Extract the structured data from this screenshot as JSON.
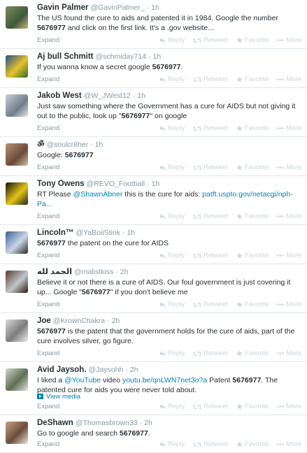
{
  "actions": {
    "reply": "Reply",
    "retweet": "Retweet",
    "favorite": "Favorite",
    "more": "More"
  },
  "expand_label": "Expand",
  "view_media_label": "View media",
  "colors": {
    "link": "#0084b4",
    "muted": "#8899a6",
    "action": "#ccd6dd",
    "divider": "#e1e8ed"
  },
  "tweets": [
    {
      "fullname": "Gavin Palmer",
      "username": "@GavinPalmer_",
      "time": "· 1h",
      "segments": [
        {
          "t": "The US found the cure to aids and patented it in 1984. Google the number "
        },
        {
          "t": "5676977",
          "b": true
        },
        {
          "t": " and click on the first link. It's a .gov website..."
        }
      ]
    },
    {
      "fullname": "Aj bull Schmitt",
      "username": "@schmiday714",
      "time": "· 1h",
      "segments": [
        {
          "t": "If you wanna know a secret google "
        },
        {
          "t": "5676977",
          "b": true
        },
        {
          "t": "."
        }
      ]
    },
    {
      "fullname": "Jakob West",
      "username": "@W_JWest12",
      "time": "· 1h",
      "segments": [
        {
          "t": "Just saw something where the Government has a cure for AIDS but not giving it out to the public, look up \""
        },
        {
          "t": "5676977",
          "b": true
        },
        {
          "t": "\" on google"
        }
      ]
    },
    {
      "fullname": "ॐ",
      "username": "@soulcr8her",
      "time": "· 1h",
      "segments": [
        {
          "t": "Google:  "
        },
        {
          "t": "5676977",
          "b": true
        }
      ]
    },
    {
      "fullname": "Tony Owens",
      "username": "@REVO_Football",
      "time": "· 1h",
      "segments": [
        {
          "t": "RT Please "
        },
        {
          "t": "@ShawnAbner",
          "l": true
        },
        {
          "t": " this is the cure for aids: "
        },
        {
          "t": "patft.uspto.gov/netacgi/nph-Pa...",
          "l": true
        }
      ]
    },
    {
      "fullname": "Lincoln™",
      "username": "@YaBoiiStink",
      "time": "· 1h",
      "segments": [
        {
          "t": "5676977",
          "b": true
        },
        {
          "t": " the patent on the cure for AIDS"
        }
      ]
    },
    {
      "fullname": "الحمد لله",
      "username": "@malistkiss",
      "time": "· 2h",
      "segments": [
        {
          "t": "Believe it or not there is a cure of AIDS. Our foul government is just covering it up... Google \""
        },
        {
          "t": "5676977",
          "b": true
        },
        {
          "t": "\" if you don't believe me"
        }
      ]
    },
    {
      "fullname": "Joe",
      "username": "@KrownChakra",
      "time": "· 2h",
      "segments": [
        {
          "t": "5676977",
          "b": true
        },
        {
          "t": " is the patent that the government holds for the cure of aids, part of the cure involves silver, go figure."
        }
      ]
    },
    {
      "fullname": "Avid Jaysoh.",
      "username": "@Jaysohh",
      "time": "· 2h",
      "segments": [
        {
          "t": "I liked a "
        },
        {
          "t": "@YouTube",
          "l": true
        },
        {
          "t": " video "
        },
        {
          "t": "youtu.be/qnLWN7net3o?a",
          "l": true
        },
        {
          "t": " Patent "
        },
        {
          "t": "5676977",
          "b": true
        },
        {
          "t": ". The patented cure for aids you were never told about."
        }
      ],
      "has_media": true
    },
    {
      "fullname": "DeShawn",
      "username": "@Thomasbrown33",
      "time": "· 2h",
      "segments": [
        {
          "t": "Go to google and search "
        },
        {
          "t": "5676977",
          "b": true
        },
        {
          "t": "."
        }
      ]
    }
  ]
}
